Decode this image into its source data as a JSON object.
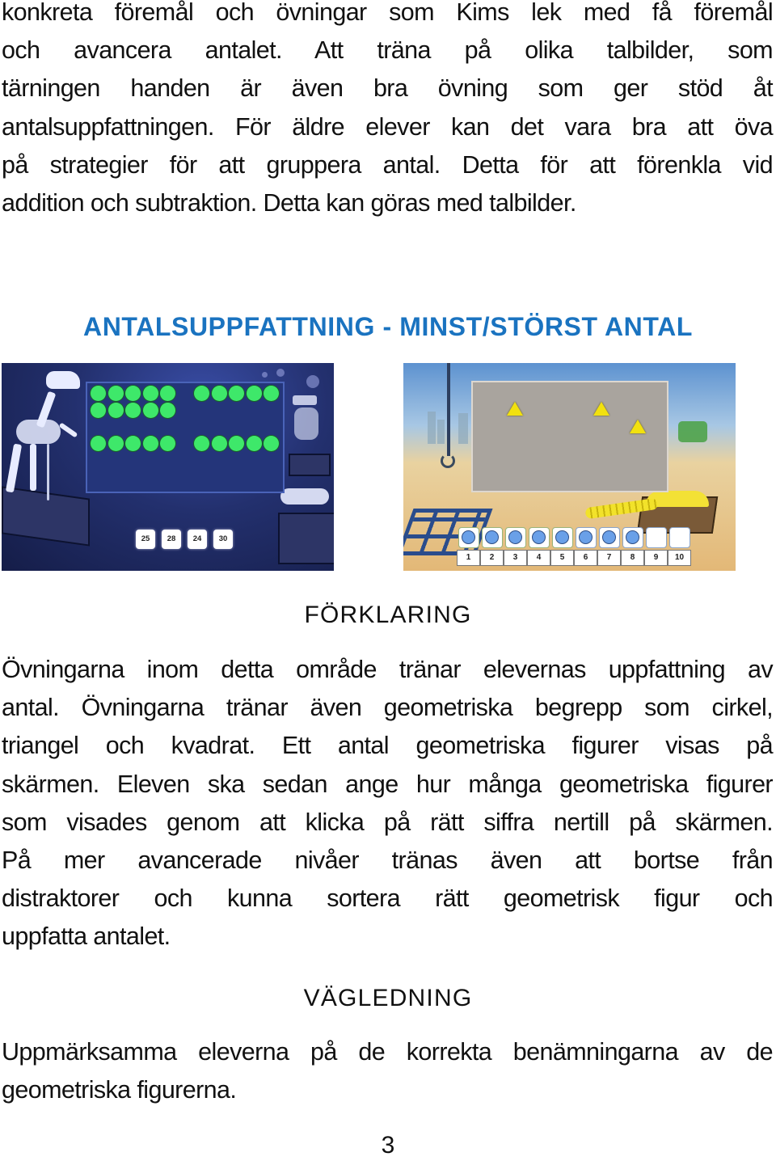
{
  "intro_paragraph": {
    "lines": [
      "konkreta föremål och övningar som Kims lek med få föremål",
      "och avancera antalet. Att träna på olika talbilder, som",
      "tärningen handen är även bra övning som ger stöd åt",
      "antalsuppfattningen. För äldre elever kan det vara bra att öva",
      "på strategier för att gruppera antal. Detta för att förenkla vid",
      "addition och subtraktion. Detta kan göras med talbilder."
    ]
  },
  "section_title": "ANTALSUPPFATTNING - MINST/STÖRST ANTAL",
  "colors": {
    "accent_title": "#1a73c0",
    "dot_green": "#3ee86a",
    "triangle_yellow": "#f2e10e",
    "tile_circle_blue": "#6aa0e8"
  },
  "screenshot_left": {
    "description": "dinosaur museum game screen with dot groups",
    "dot_groups": [
      {
        "count": 10
      },
      {
        "count": 5
      },
      {
        "count": 5
      },
      {
        "count": 5
      }
    ],
    "answer_buttons": [
      "25",
      "28",
      "24",
      "30"
    ]
  },
  "screenshot_right": {
    "description": "construction site game screen with triangles",
    "triangles_shown": 3,
    "filled_tiles": 8,
    "total_tiles": 10,
    "number_buttons": [
      "1",
      "2",
      "3",
      "4",
      "5",
      "6",
      "7",
      "8",
      "9",
      "10"
    ]
  },
  "forklaring": {
    "heading": "FÖRKLARING",
    "lines": [
      "Övningarna inom detta område tränar elevernas uppfattning av",
      "antal. Övningarna tränar även geometriska begrepp som cirkel,",
      "triangel och kvadrat. Ett antal geometriska figurer visas på",
      "skärmen. Eleven ska sedan ange hur många geometriska figurer",
      "som visades genom att klicka på rätt siffra nertill på skärmen.",
      "På mer avancerade nivåer tränas även att bortse från",
      "distraktorer och kunna sortera rätt geometrisk figur och",
      "uppfatta antalet."
    ]
  },
  "vagledning": {
    "heading": "VÄGLEDNING",
    "lines": [
      "Uppmärksamma eleverna på de korrekta benämningarna av de",
      "geometriska figurerna."
    ]
  },
  "page_number": "3"
}
